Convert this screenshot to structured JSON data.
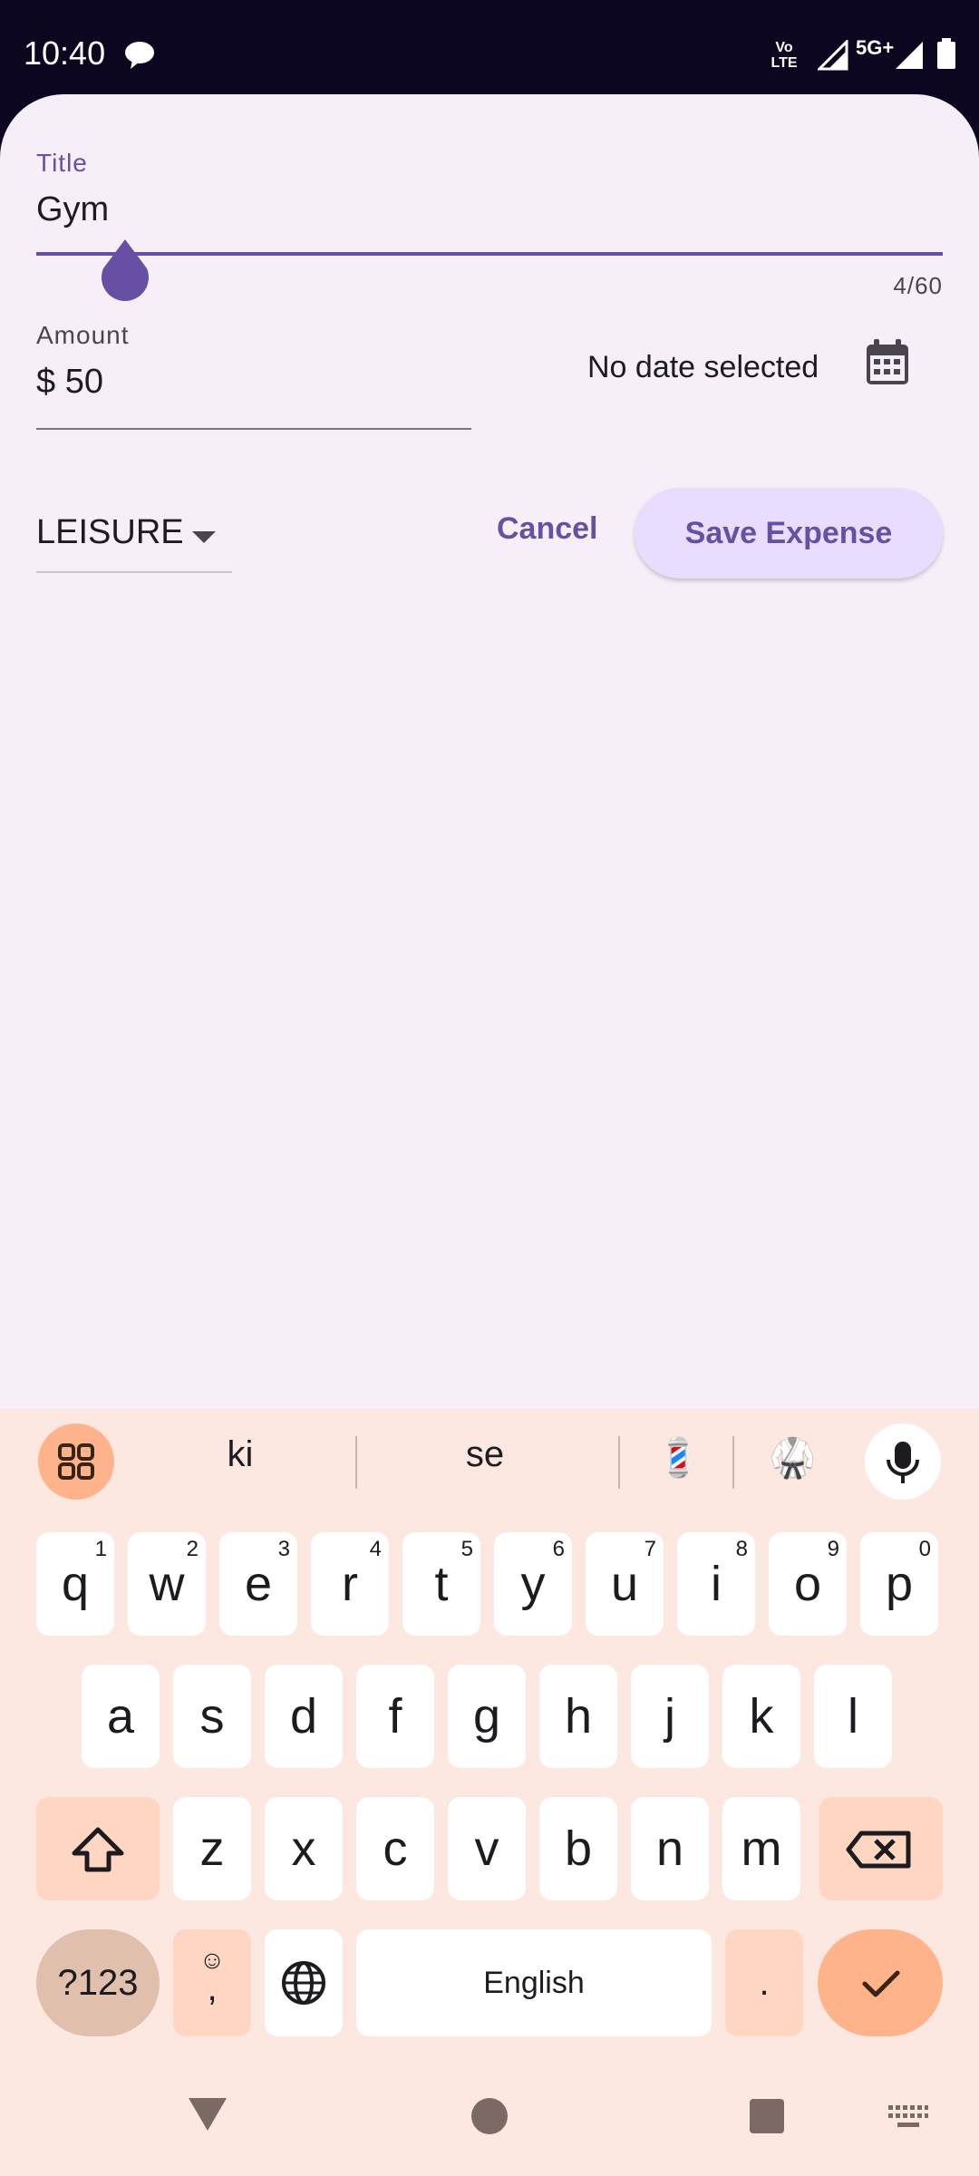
{
  "status_bar": {
    "time": "10:40",
    "volte": "Vo LTE",
    "network": "5G+"
  },
  "form": {
    "title_label": "Title",
    "title_value": "Gym",
    "title_counter": "4/60",
    "amount_label": "Amount",
    "amount_value": "$ 50",
    "date_text": "No date selected",
    "category": "LEISURE",
    "cancel_label": "Cancel",
    "save_label": "Save Expense"
  },
  "keyboard": {
    "suggestions": [
      "ki",
      "se"
    ],
    "emoji_suggestions": [
      "💈",
      "🥋"
    ],
    "row1": [
      {
        "k": "q",
        "n": "1"
      },
      {
        "k": "w",
        "n": "2"
      },
      {
        "k": "e",
        "n": "3"
      },
      {
        "k": "r",
        "n": "4"
      },
      {
        "k": "t",
        "n": "5"
      },
      {
        "k": "y",
        "n": "6"
      },
      {
        "k": "u",
        "n": "7"
      },
      {
        "k": "i",
        "n": "8"
      },
      {
        "k": "o",
        "n": "9"
      },
      {
        "k": "p",
        "n": "0"
      }
    ],
    "row2": [
      "a",
      "s",
      "d",
      "f",
      "g",
      "h",
      "j",
      "k",
      "l"
    ],
    "row3": [
      "z",
      "x",
      "c",
      "v",
      "b",
      "n",
      "m"
    ],
    "symbols_label": "?123",
    "comma": ",",
    "space_label": "English",
    "period": "."
  },
  "colors": {
    "accent": "#6750a4",
    "keyboard_bg": "#fce8e0",
    "enter": "#ffb38a"
  }
}
